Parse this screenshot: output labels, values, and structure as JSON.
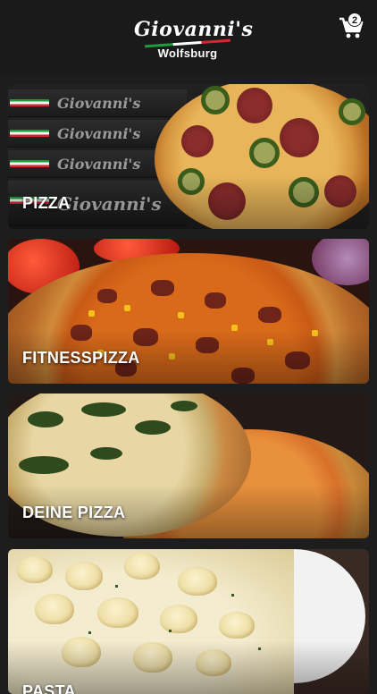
{
  "header": {
    "logo_text": "Giovanni's",
    "city": "Wolfsburg",
    "cart_count": "2",
    "cart_icon": "shopping-cart-icon",
    "colors": {
      "background": "#1a1a1a",
      "flag_green": "#1f9a3c",
      "flag_white": "#ffffff",
      "flag_red": "#d8262e"
    }
  },
  "categories": [
    {
      "label": "PIZZA",
      "box_text": "Giovanni's"
    },
    {
      "label": "FITNESSPIZZA"
    },
    {
      "label": "DEINE PIZZA"
    },
    {
      "label": "PASTA"
    }
  ]
}
